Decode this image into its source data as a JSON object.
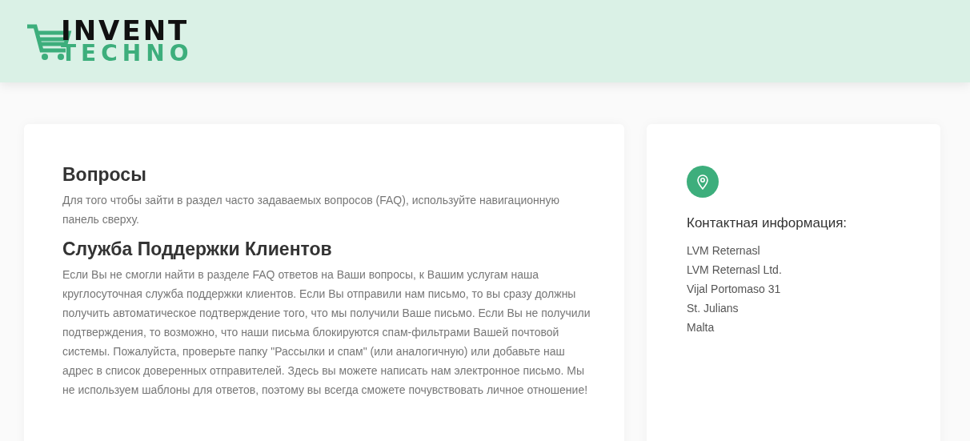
{
  "header": {
    "logo": {
      "line_1": "INVENT",
      "line_2": "TECHNO"
    }
  },
  "sections": [
    {
      "title": "Вопросы",
      "text": "Для того чтобы зайти в раздел часто задаваемых вопросов (FAQ), используйте навигационную панель сверху."
    },
    {
      "title": "Служба Поддержки Клиентов",
      "text": "Если Вы не смогли найти в разделе FAQ ответов на Ваши вопросы, к Вашим услугам наша круглосуточная служба поддержки клиентов. Если Вы отправили нам письмо, то вы сразу должны получить автоматическое подтверждение того, что мы получили Ваше письмо. Если Вы не получили подтверждения, то возможно, что наши письма блокируются спам-фильтрами Вашей почтовой системы. Пожалуйста, проверьте папку \"Рассылки и спам\" (или аналогичную) или добавьте наш адрес в список доверенных отправителей. Здесь вы можете написать нам электронное письмо. Мы не используем шаблоны для ответов, поэтому вы всегда сможете почувствовать личное отношение!"
    }
  ],
  "contact": {
    "title": "Контактная информация:",
    "lines": [
      "LVM Reternasl",
      "LVM Reternasl Ltd.",
      "Vijal Portomaso 31",
      "St. Julians",
      "Malta"
    ]
  }
}
